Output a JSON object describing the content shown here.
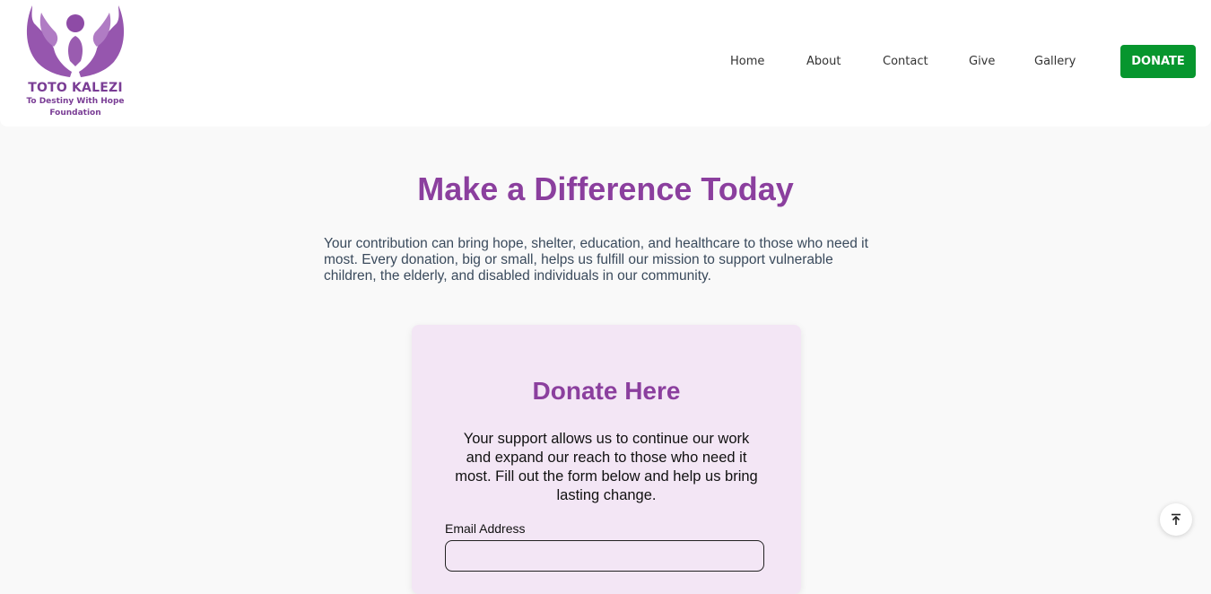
{
  "brand": {
    "name": "TOTO KALEZI",
    "tagline_line1": "To Destiny With Hope",
    "tagline_line2": "Foundation",
    "color": "#8b3f9e"
  },
  "nav": {
    "items": [
      {
        "label": "Home"
      },
      {
        "label": "About"
      },
      {
        "label": "Contact"
      },
      {
        "label": "Give"
      },
      {
        "label": "Gallery"
      }
    ],
    "cta_label": "DONATE",
    "cta_color": "#07962e"
  },
  "hero": {
    "title": "Make a Difference Today",
    "text": "Your contribution can bring hope, shelter, education, and healthcare to those who need it most. Every donation, big or small, helps us fulfill our mission to support vulnerable children, the elderly, and disabled individuals in our community."
  },
  "donate_card": {
    "title": "Donate Here",
    "text": "Your support allows us to continue our work and expand our reach to those who need it most. Fill out the form below and help us bring lasting change.",
    "email_label": "Email Address",
    "email_value": "",
    "background": "#f3e6f5"
  },
  "icons": {
    "logo": "hands-holding-person-icon",
    "scroll_top": "arrow-up-to-line-icon"
  }
}
